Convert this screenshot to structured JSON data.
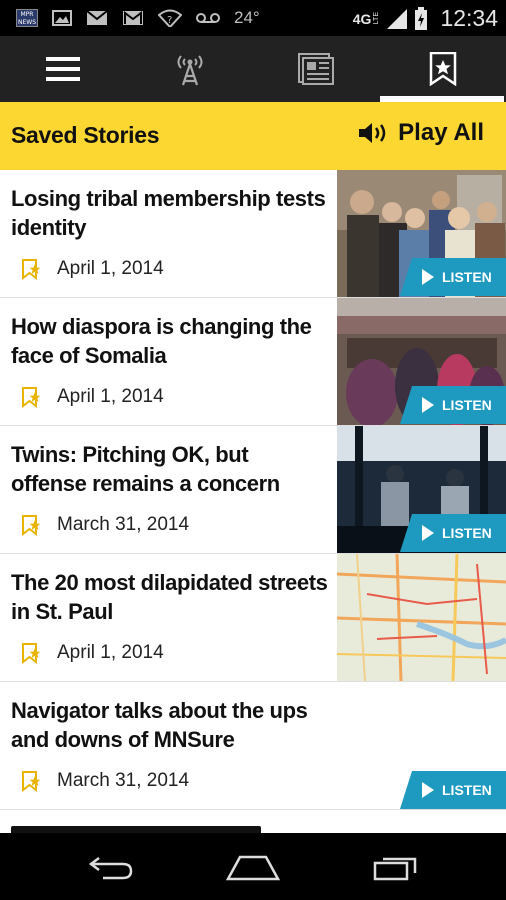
{
  "status_bar": {
    "notification_icons": [
      "mpr-news-icon",
      "image-icon",
      "gmail-icon",
      "gmail-icon",
      "wifi-question-icon",
      "voicemail-icon"
    ],
    "mpr_badge": "MPR NEWS",
    "temperature": "24°",
    "network": "4G",
    "network_sub": "LTE",
    "time": "12:34"
  },
  "nav": {
    "tabs": [
      {
        "name": "menu",
        "icon": "hamburger-icon"
      },
      {
        "name": "live",
        "icon": "radio-tower-icon"
      },
      {
        "name": "news",
        "icon": "newspaper-icon"
      },
      {
        "name": "saved",
        "icon": "bookmark-star-icon",
        "active": true
      }
    ]
  },
  "header": {
    "title": "Saved Stories",
    "play_all": "Play All"
  },
  "colors": {
    "accent_yellow": "#fcd732",
    "listen_blue": "#1e9ac0",
    "nav_bg": "#222222"
  },
  "stories": [
    {
      "title": "Losing tribal membership tests identity",
      "date": "April 1, 2014",
      "listen": "LISTEN",
      "thumb": "people-group"
    },
    {
      "title": "How diaspora is changing the face of Somalia",
      "date": "April 1, 2014",
      "listen": "LISTEN",
      "thumb": "market"
    },
    {
      "title": "Twins: Pitching OK, but offense remains a concern",
      "date": "March 31, 2014",
      "listen": "LISTEN",
      "thumb": "baseball"
    },
    {
      "title": "The 20 most dilapidated streets in St. Paul",
      "date": "April 1, 2014",
      "listen": "",
      "thumb": "map"
    },
    {
      "title": "Navigator talks about the ups and downs of MNSure",
      "date": "March 31, 2014",
      "listen": "LISTEN",
      "thumb": ""
    }
  ]
}
